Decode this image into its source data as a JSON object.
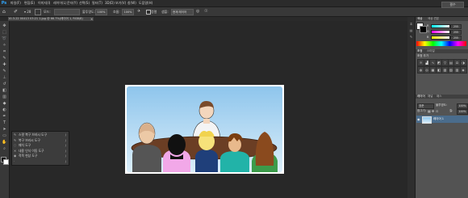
{
  "app": {
    "logo": "Ps"
  },
  "menubar": {
    "items": [
      "파일(F)",
      "편집(E)",
      "이미지(I)",
      "레이어(L)",
      "문자(Y)",
      "선택(S)",
      "필터(T)",
      "3D(D)",
      "보기(V)",
      "창(W)",
      "도움말(H)"
    ]
  },
  "options": {
    "mode_value": "모드:",
    "opacity_label": "불투명도:",
    "opacity_value": "100%",
    "flow_label": "흐름:",
    "flow_value": "100%",
    "align_label": "정렬",
    "sample_label": "샘플:",
    "sample_value": "현재 레이어",
    "workspace_value": "필수"
  },
  "document": {
    "tab_title": "10-3-22 00413 03:21 1.jpg @ 66.7%(레이어 1, RGB/8)"
  },
  "flyout": {
    "items": [
      {
        "icon": "spot-healing-icon",
        "glyph": "✎",
        "label": "스팟 복구 브러시 도구",
        "key": "J"
      },
      {
        "icon": "healing-brush-icon",
        "glyph": "✎",
        "label": "복구 브러시 도구",
        "key": "J"
      },
      {
        "icon": "patch-icon",
        "glyph": "◌",
        "label": "패치 도구",
        "key": "J"
      },
      {
        "icon": "content-aware-move-icon",
        "glyph": "✕",
        "label": "내용 인식 이동 도구",
        "key": "J"
      },
      {
        "icon": "red-eye-icon",
        "glyph": "◉",
        "label": "적목 현상 도구",
        "key": "J"
      },
      {
        "icon": "extra-icon",
        "glyph": "·",
        "label": "",
        "key": "J"
      }
    ]
  },
  "color_panel": {
    "tabs": [
      "색상",
      "색상 견본"
    ],
    "channels": [
      {
        "label": "R",
        "value": "255"
      },
      {
        "label": "G",
        "value": "255"
      },
      {
        "label": "B",
        "value": "255"
      }
    ]
  },
  "adjust_panel": {
    "tabs": [
      "조정",
      "스타일"
    ],
    "title": "조정 추가"
  },
  "layers_panel": {
    "tabs": [
      "레이어",
      "채널",
      "패스"
    ],
    "blend_mode": "표준",
    "opacity_label": "불투명도:",
    "opacity_value": "100%",
    "lock_label": "잠그기:",
    "fill_label": "칠:",
    "fill_value": "100%",
    "layer_name": "레이어 1"
  },
  "colors": {
    "accent": "#31a8ff",
    "panel_bg": "#535353",
    "selected_layer": "#4a6c8c",
    "sky_top": "#8ec5ec",
    "sky_bottom": "#dbeefa"
  }
}
